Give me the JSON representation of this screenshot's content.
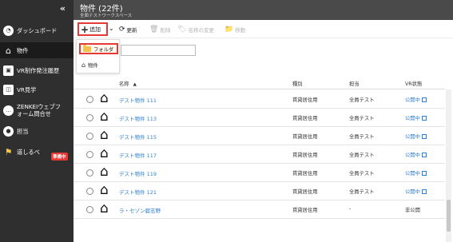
{
  "sidebar": {
    "collapse_label": "«",
    "items": [
      {
        "label": "ダッシュボード",
        "icon": "dashboard-icon"
      },
      {
        "label": "物件",
        "icon": "house-icon"
      },
      {
        "label": "VR制作発注履歴",
        "icon": "cube-icon"
      },
      {
        "label": "VR見学",
        "icon": "vr-icon"
      },
      {
        "label": "ZENKEIウェブフォーム問合せ",
        "icon": "chat-icon"
      },
      {
        "label": "担当",
        "icon": "person-icon"
      },
      {
        "label": "道しるべ",
        "icon": "signpost-icon"
      }
    ],
    "badge": "準備中"
  },
  "header": {
    "title": "物件 (22件)",
    "subtitle": "全面テストワークスペース"
  },
  "toolbar": {
    "add_label": "追加",
    "refresh_label": "更新",
    "delete_label": "削除",
    "rename_label": "名称の変更",
    "move_label": "移動"
  },
  "dropdown": {
    "items": [
      {
        "label": "フォルダ",
        "icon": "folder-icon"
      },
      {
        "label": "物件",
        "icon": "house-icon"
      }
    ]
  },
  "search": {
    "value": ""
  },
  "table": {
    "headers": {
      "name": "名称",
      "type": "種別",
      "owner": "担当",
      "vr": "VR状態"
    },
    "sort_icon": "▲",
    "rows": [
      {
        "name": "デスト物件 111",
        "type": "賃貸居住用",
        "owner": "全員テスト",
        "vr": "公開中",
        "vr_public": true
      },
      {
        "name": "デスト物件 113",
        "type": "賃貸居住用",
        "owner": "全員テスト",
        "vr": "公開中",
        "vr_public": true
      },
      {
        "name": "デスト物件 115",
        "type": "賃貸居住用",
        "owner": "全員テスト",
        "vr": "公開中",
        "vr_public": true
      },
      {
        "name": "デスト物件 117",
        "type": "賃貸居住用",
        "owner": "全員テスト",
        "vr": "公開中",
        "vr_public": true
      },
      {
        "name": "デスト物件 119",
        "type": "賃貸居住用",
        "owner": "全員テスト",
        "vr": "公開中",
        "vr_public": true
      },
      {
        "name": "デスト物件 121",
        "type": "賃貸居住用",
        "owner": "全員テスト",
        "vr": "公開中",
        "vr_public": true
      },
      {
        "name": "ラ・セゾン碧志野",
        "type": "賃貸居住用",
        "owner": "-",
        "vr": "非公開",
        "vr_public": false
      }
    ]
  },
  "colors": {
    "sidebar": "#2f2f2f",
    "header": "#4a4a4a",
    "link": "#2f7fd1",
    "highlight": "#e53935"
  }
}
